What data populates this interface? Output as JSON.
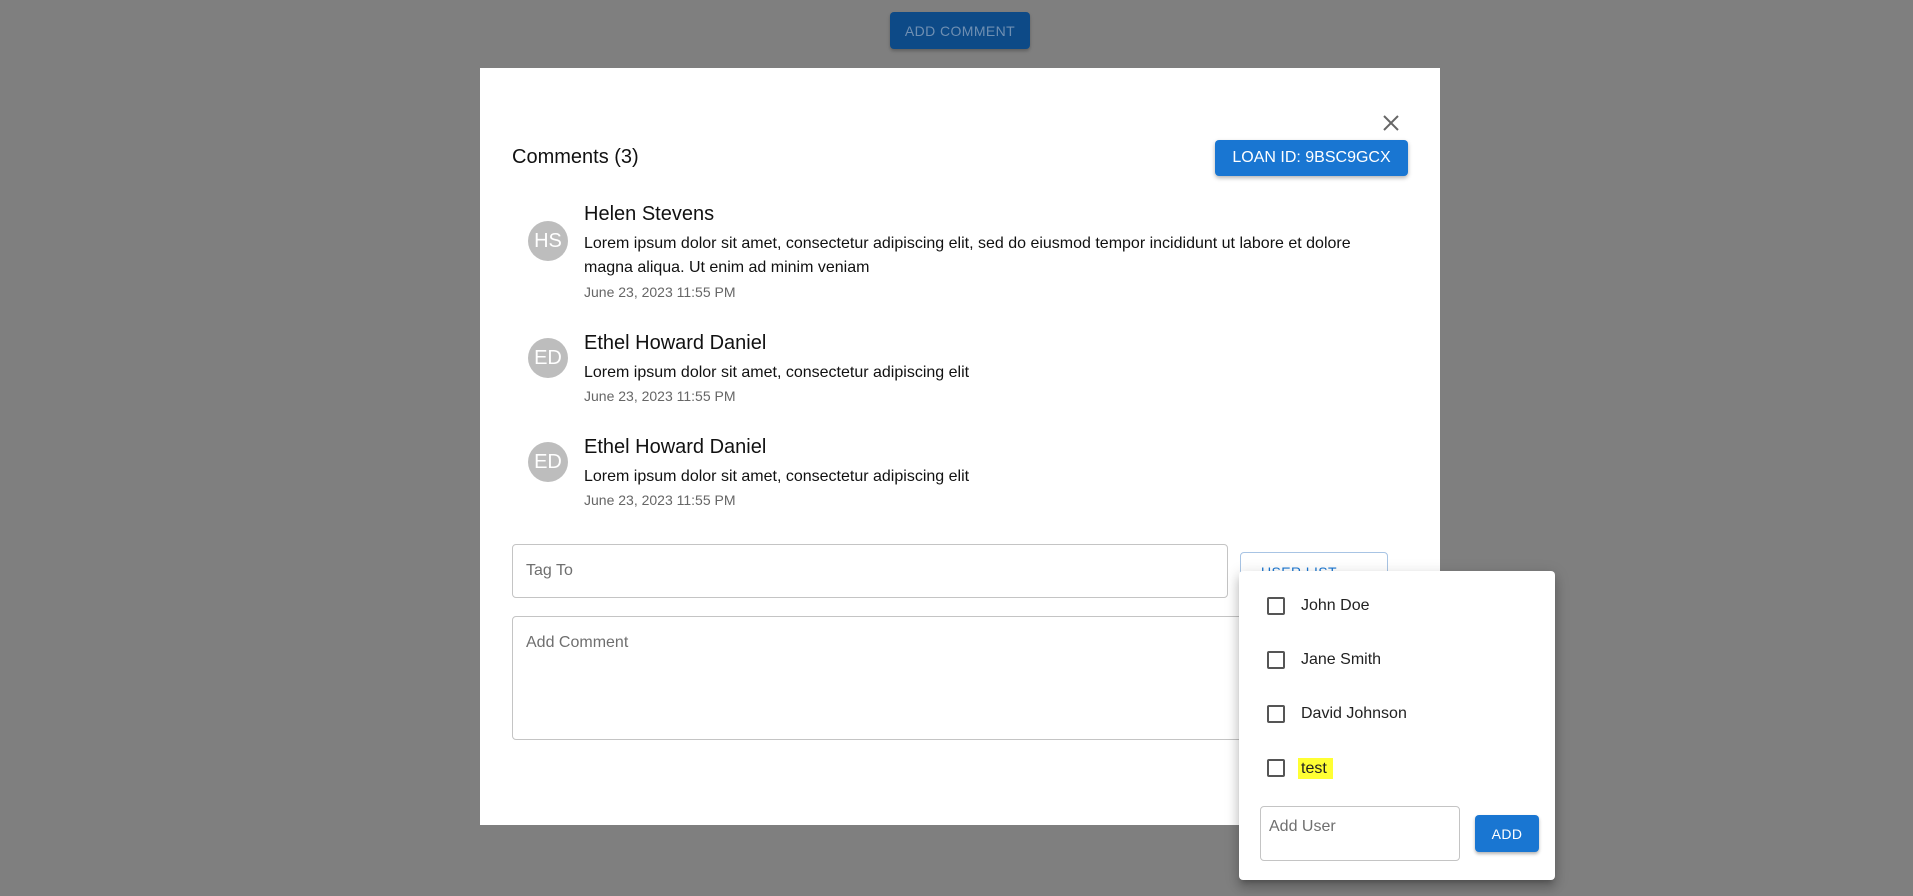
{
  "header": {
    "add_comment_label": "ADD COMMENT"
  },
  "modal": {
    "title": "Comments (3)",
    "loan_chip": "LOAN ID: 9BSC9GCX",
    "close_icon": "close-icon"
  },
  "comments": [
    {
      "initials": "HS",
      "author": "Helen Stevens",
      "text": "Lorem ipsum dolor sit amet, consectetur adipiscing elit, sed do eiusmod tempor incididunt ut labore et dolore magna aliqua. Ut enim ad minim veniam",
      "date": "June 23, 2023 11:55 PM"
    },
    {
      "initials": "ED",
      "author": "Ethel Howard Daniel",
      "text": "Lorem ipsum dolor sit amet, consectetur adipiscing elit",
      "date": "June 23, 2023 11:55 PM"
    },
    {
      "initials": "ED",
      "author": "Ethel Howard Daniel",
      "text": "Lorem ipsum dolor sit amet, consectetur adipiscing elit",
      "date": "June 23, 2023 11:55 PM"
    }
  ],
  "form": {
    "tag_placeholder": "Tag To",
    "comment_placeholder": "Add Comment",
    "user_list_label": "USER LIST"
  },
  "user_menu": {
    "users": [
      {
        "name": "John Doe",
        "checked": false
      },
      {
        "name": "Jane Smith",
        "checked": false
      },
      {
        "name": "David Johnson",
        "checked": false
      },
      {
        "name": "test",
        "checked": false,
        "highlighted": true
      }
    ],
    "add_user_placeholder": "Add User",
    "add_label": "ADD"
  },
  "colors": {
    "primary": "#1976d2",
    "backdrop": "#7f7f7f",
    "avatar": "#bdbdbd",
    "highlight": "#ffff33"
  }
}
